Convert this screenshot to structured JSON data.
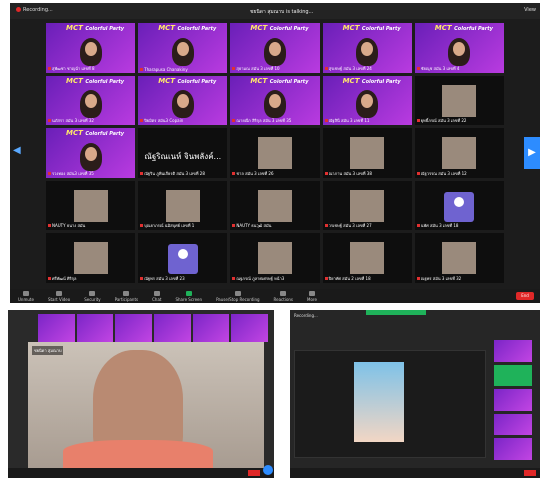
{
  "top": {
    "recording": "Recording...",
    "speaking": "ชยนิดา สุมณาบ is talking...",
    "view": "View",
    "brand": "MCT",
    "brand_sub": "Colorful Party",
    "tiles": [
      {
        "label": "สุพัฒชา ชาญฉ่ำ เลขที่ 8",
        "kind": "purple"
      },
      {
        "label": "Tharapusa Chanakiny",
        "kind": "purple"
      },
      {
        "label": "สุธามณ สมัน 3 เลขที่ 10",
        "kind": "purple"
      },
      {
        "label": "สุรเชษฐ์ สมัน 3 เลขที่ 24",
        "kind": "purple"
      },
      {
        "label": "ชัยณุช สมัน 3 เลขที่ 4",
        "kind": "purple"
      },
      {
        "label": "นภัสรา สมัน 3 เลขที่ 32",
        "kind": "purple"
      },
      {
        "label": "ปิยมิตร สมัน3 Copain",
        "kind": "purple"
      },
      {
        "label": "ณายณีก สิริกุล สมัน 3 เลขที่ 35",
        "kind": "purple"
      },
      {
        "label": "ณัฐสินี สมัน 3 เลขที่ 11",
        "kind": "purple"
      },
      {
        "label": "ยุทธิ์ภรณ์ สมัน 3 เลขที่ 22",
        "kind": "photo"
      },
      {
        "label": "รวงทอง สมัน3 เลขที่ 35",
        "kind": "purple"
      },
      {
        "label": "ณัฐริน ภูพินเกียรติ สมัน 3 เลขที่ 28",
        "kind": "name",
        "bigname": "ณัฐริณเนห์ จินพลังค์..."
      },
      {
        "label": "ชาล สมัน 3 เลขที่ 26",
        "kind": "photo"
      },
      {
        "label": "ณาภาน สมัน 3 เลขที่ 38",
        "kind": "photo"
      },
      {
        "label": "ณัฐวรรณ สมัน 3 เลขที่ 12",
        "kind": "photo"
      },
      {
        "label": "NAUTY ธนาง สมัน",
        "kind": "photo"
      },
      {
        "label": "บุณยาภรณ์ ฉมิสบุศย์ เลขที่ 1",
        "kind": "photo"
      },
      {
        "label": "NAUTY ธนวุฒิ สมัน",
        "kind": "photo"
      },
      {
        "label": "วรเชษฐ์ สมัน 3 เลขที่ 27",
        "kind": "photo"
      },
      {
        "label": "นพัศ สมัน 3 เลขที่ 18",
        "kind": "avatar"
      },
      {
        "label": "ศรีพัฒน์ ศิริกุล",
        "kind": "photo"
      },
      {
        "label": "ณัฐพร สมัน 3 เลขที่ 23",
        "kind": "avatar"
      },
      {
        "label": "ณฐภรณ์ ภูลาศเศรษฐ์ หน้า3",
        "kind": "photo"
      },
      {
        "label": "ปิยาทัศ สมัน 2 เลขที่ 18",
        "kind": "photo"
      },
      {
        "label": "ณฐพร สมัน 3 เลขที่ 32",
        "kind": "photo"
      }
    ],
    "toolbar": [
      {
        "label": "Unmute"
      },
      {
        "label": "Start Video"
      },
      {
        "label": "Security"
      },
      {
        "label": "Participants"
      },
      {
        "label": "Chat"
      },
      {
        "label": "Share Screen",
        "green": true
      },
      {
        "label": "Pause/Stop Recording"
      },
      {
        "label": "Reactions"
      },
      {
        "label": "More"
      }
    ],
    "end": "End"
  },
  "bottom_left": {
    "speaker_label": "ชยนิดา สุมณาบ"
  },
  "bottom_right": {
    "recording": "Recording..."
  }
}
